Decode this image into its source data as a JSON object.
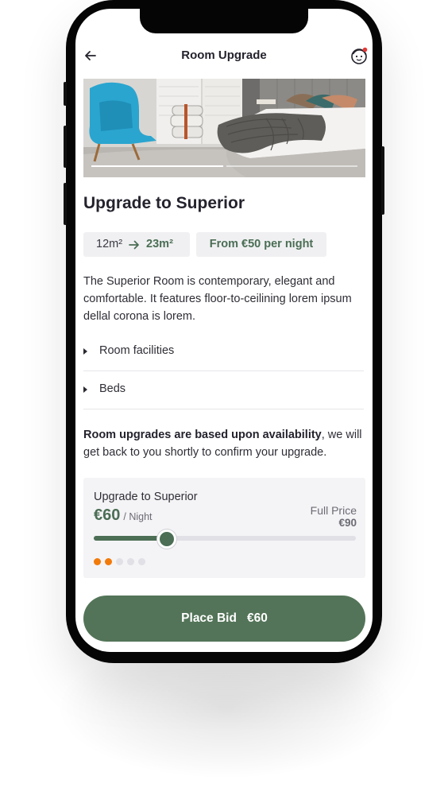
{
  "header": {
    "title": "Room Upgrade"
  },
  "hero": {
    "slides": 2,
    "active_slide": 1
  },
  "room": {
    "title": "Upgrade to Superior",
    "size_from": "12m²",
    "size_to": "23m²",
    "price_chip": "From €50 per night",
    "description": "The Superior Room is contemporary, elegant and comfortable. It features floor-to-ceilining lorem ipsum dellal corona is lorem."
  },
  "accordion": [
    {
      "label": "Room facilities"
    },
    {
      "label": "Beds"
    }
  ],
  "notice": {
    "bold": "Room upgrades are based upon availability",
    "rest": ", we will get back to you shortly to confirm your upgrade."
  },
  "bid": {
    "label": "Upgrade to Superior",
    "amount": "€60",
    "unit": "/ Night",
    "full_price_label": "Full Price",
    "full_price_value": "€90",
    "slider_fraction": 0.28,
    "dots_total": 5,
    "dots_active": 2
  },
  "action": {
    "label": "Place Bid",
    "amount": "€60"
  },
  "colors": {
    "accent": "#4b6e55",
    "button": "#537458",
    "dot_active": "#f27a0a"
  }
}
